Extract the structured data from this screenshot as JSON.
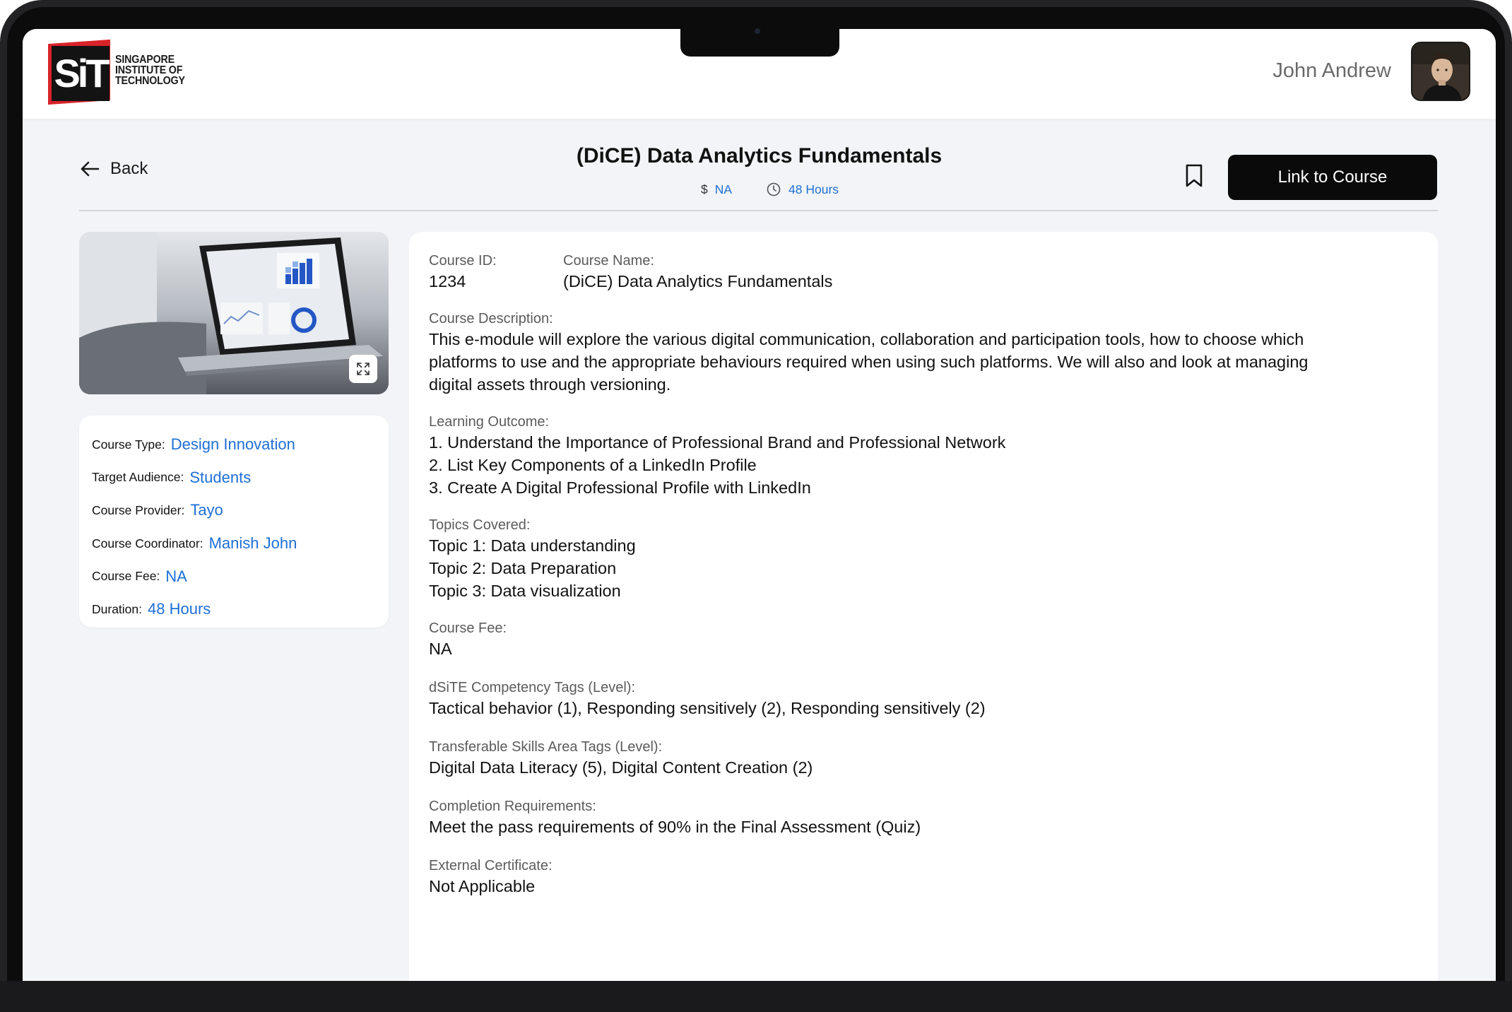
{
  "header": {
    "logo_mark": "SiT",
    "logo_text_lines": [
      "SINGAPORE",
      "INSTITUTE OF",
      "TECHNOLOGY"
    ],
    "user_name": "John Andrew"
  },
  "nav": {
    "back_label": "Back",
    "course_title": "(DiCE) Data Analytics Fundamentals",
    "currency_symbol": "$",
    "fee_value": "NA",
    "duration_value": "48 Hours",
    "link_button_label": "Link to Course"
  },
  "summary": {
    "rows": [
      {
        "label": "Course Type:",
        "value": "Design Innovation"
      },
      {
        "label": "Target Audience:",
        "value": "Students"
      },
      {
        "label": "Course Provider:",
        "value": "Tayo"
      },
      {
        "label": "Course Coordinator:",
        "value": "Manish John"
      },
      {
        "label": "Course Fee:",
        "value": "NA"
      },
      {
        "label": "Duration:",
        "value": "48 Hours"
      }
    ]
  },
  "details": {
    "course_id_label": "Course ID:",
    "course_id": "1234",
    "course_name_label": "Course Name:",
    "course_name": "(DiCE) Data Analytics Fundamentals",
    "description_label": "Course Description:",
    "description_lines": [
      "This e-module will explore the various digital communication, collaboration and participation tools, how to choose which",
      "platforms to use and the appropriate behaviours required when using such platforms. We will also and look at managing",
      "digital assets through versioning."
    ],
    "outcome_label": "Learning Outcome:",
    "outcomes": [
      "1. Understand the Importance of Professional Brand and Professional Network",
      "2. List Key Components of a LinkedIn Profile",
      "3. Create A Digital Professional Profile with LinkedIn"
    ],
    "topics_label": "Topics Covered:",
    "topics": [
      "Topic 1: Data understanding",
      "Topic 2: Data Preparation",
      "Topic 3: Data visualization"
    ],
    "fee_label": "Course Fee:",
    "fee": "NA",
    "competency_label": "dSiTE Competency Tags (Level):",
    "competency": "Tactical behavior (1), Responding sensitively (2), Responding sensitively (2)",
    "transferable_label": "Transferable Skills Area Tags (Level):",
    "transferable": "Digital Data Literacy (5), Digital Content Creation (2)",
    "completion_label": "Completion Requirements:",
    "completion": "Meet the pass requirements of 90% in the Final Assessment (Quiz)",
    "certificate_label": "External Certificate:",
    "certificate": "Not Applicable"
  },
  "icons": {
    "back": "arrow-left-icon",
    "clock": "clock-icon",
    "bookmark": "bookmark-icon",
    "expand": "expand-icon"
  },
  "colors": {
    "accent": "#1e6fd6",
    "button": "#0a0a0a",
    "background": "#f2f4f7",
    "brand_red": "#d8232a"
  }
}
